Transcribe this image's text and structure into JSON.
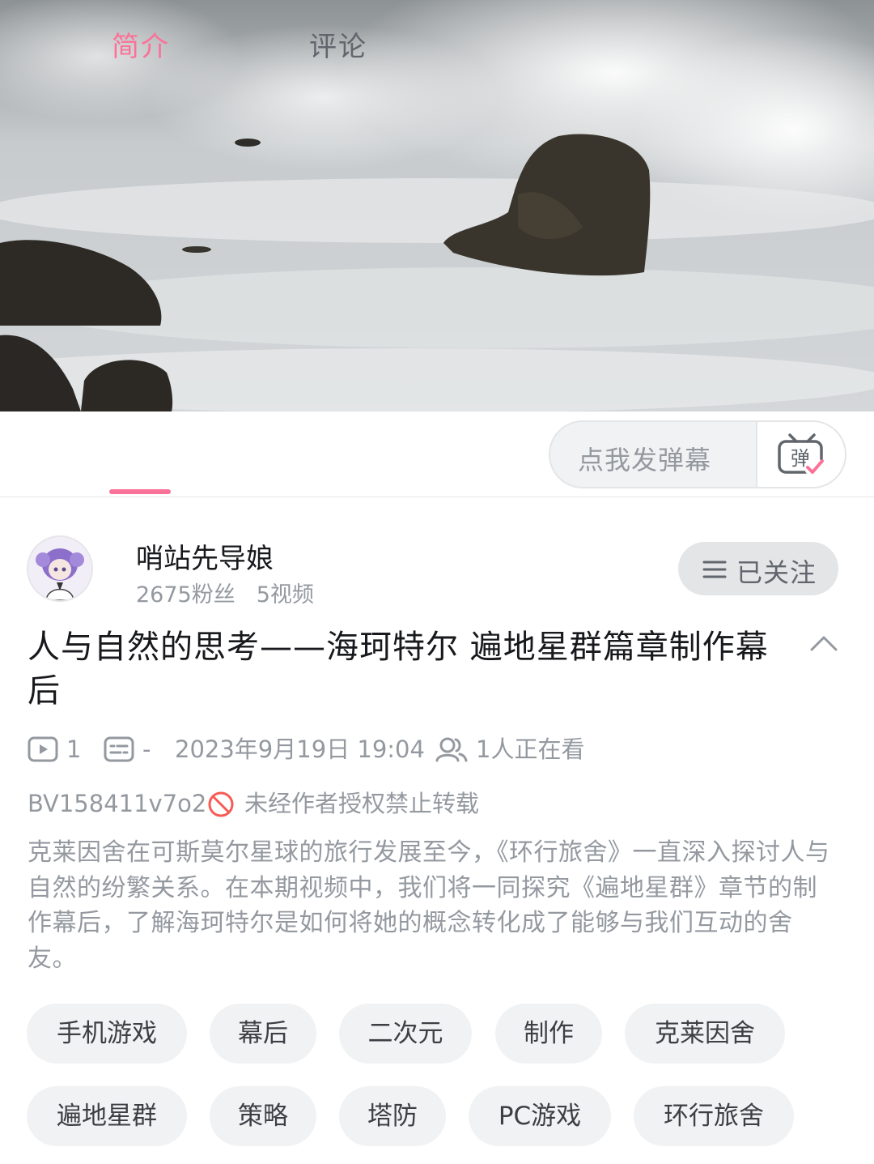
{
  "tabs": {
    "intro_label": "简介",
    "comments_label": "评论",
    "active": "简介",
    "accent_color": "#fb7299"
  },
  "danmaku": {
    "placeholder": "点我发弹幕",
    "toggle_icon": "danmaku-toggle-icon",
    "toggle_glyph": "弹"
  },
  "uploader": {
    "name": "哨站先导娘",
    "fans": "2675粉丝",
    "videos": "5视频",
    "follow_label": "已关注",
    "follow_icon": "menu-icon"
  },
  "video": {
    "title": "人与自然的思考——海珂特尔 遍地星群篇章制作幕后",
    "plays": "1",
    "danmaku_count": "-",
    "date": "2023年9月19日 19:04",
    "watching": "1人正在看",
    "bvid": "BV158411v7o2",
    "copyright_notice": "未经作者授权禁止转载",
    "description": "克莱因舍在可斯莫尔星球的旅行发展至今，《环行旅舍》一直深入探讨人与自然的纷繁关系。在本期视频中，我们将一同探究《遍地星群》章节的制作幕后，了解海珂特尔是如何将她的概念转化成了能够与我们互动的舍友。"
  },
  "tags": [
    "手机游戏",
    "幕后",
    "二次元",
    "制作",
    "克莱因舍",
    "遍地星群",
    "策略",
    "塔防",
    "PC游戏",
    "环行旅舍"
  ]
}
